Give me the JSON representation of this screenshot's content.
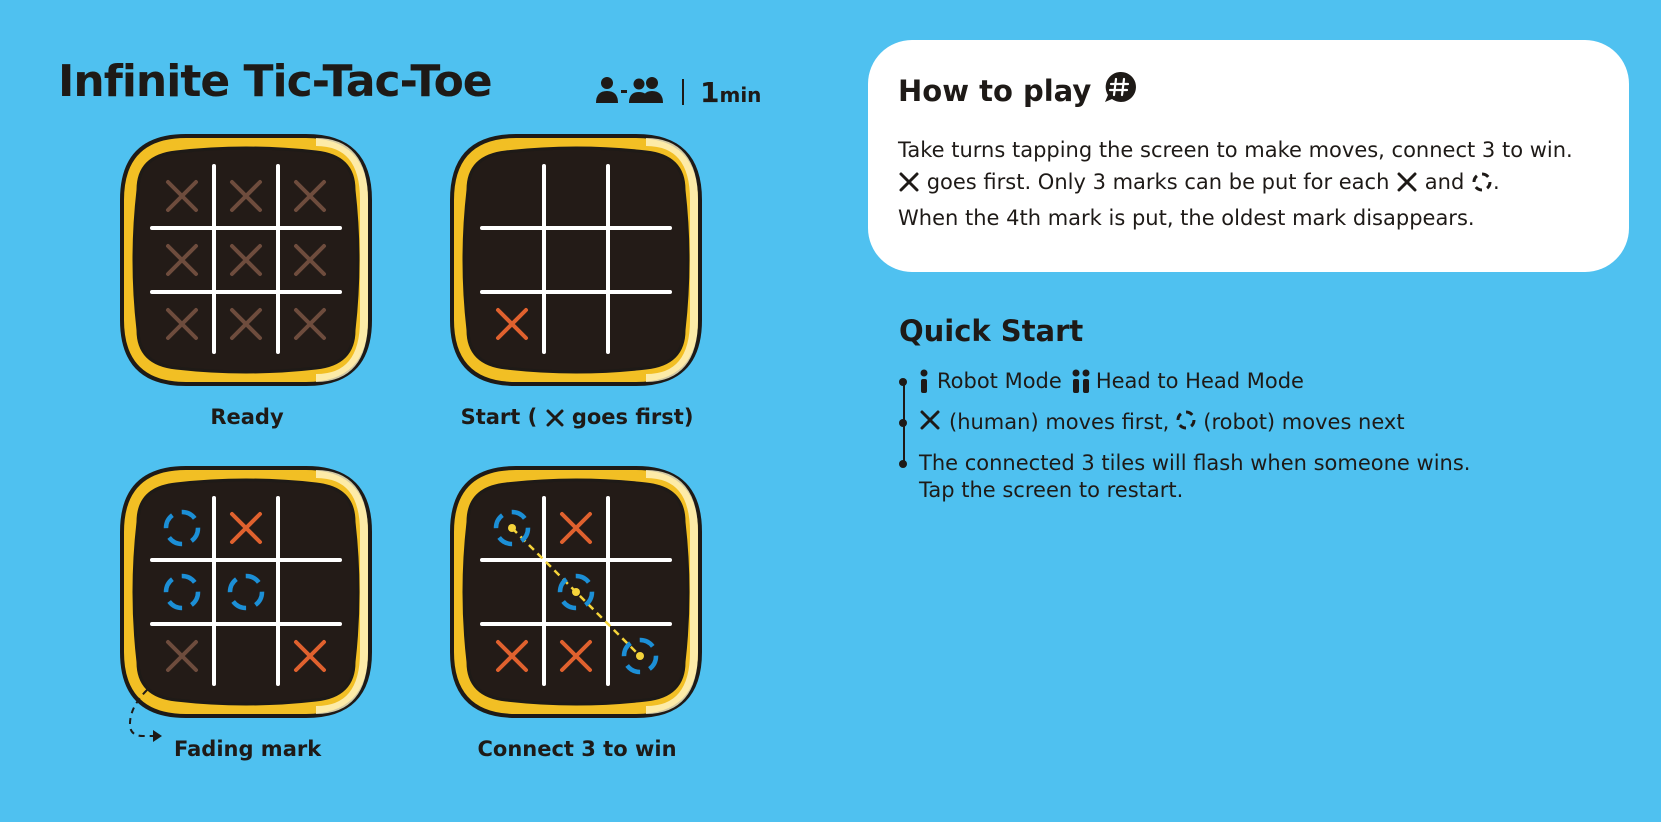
{
  "title": "Infinite Tic-Tac-Toe",
  "meta": {
    "players_icon": "one-to-two-players-icon",
    "duration_value": "1",
    "duration_unit": "min"
  },
  "colors": {
    "background": "#4fc1f0",
    "board_frame": "#f2bf24",
    "board_surface": "#231b17",
    "x_active": "#e0612e",
    "x_faded": "#6e4c3d",
    "o_mark": "#1c8fd6",
    "win_line": "#f5d33a"
  },
  "boards": [
    {
      "caption": "Ready",
      "cells": [
        "xf",
        "xf",
        "xf",
        "xf",
        "xf",
        "xf",
        "xf",
        "xf",
        "xf"
      ]
    },
    {
      "caption_prefix": "Start (",
      "caption_icon": "x-icon",
      "caption_suffix": "goes first)",
      "cells": [
        "",
        "",
        "",
        "",
        "",
        "",
        "x",
        "",
        ""
      ]
    },
    {
      "caption": "Fading mark",
      "cells": [
        "o",
        "x",
        "",
        "o",
        "o",
        "",
        "xf",
        "",
        "x"
      ]
    },
    {
      "caption": "Connect 3 to win",
      "cells": [
        "o",
        "x",
        "",
        "",
        "o",
        "",
        "x",
        "x",
        "o"
      ],
      "win_line": [
        0,
        4,
        8
      ]
    }
  ],
  "how_to_play": {
    "heading": "How to play",
    "icon": "hash-speech-bubble-icon",
    "text_1": "Take turns tapping the screen to make moves, connect 3 to win.",
    "text_2": "goes first. Only 3 marks can be put for each",
    "text_3": "and",
    "text_4": ".",
    "text_5": "When the 4th mark is put, the oldest mark disappears."
  },
  "quick_start": {
    "heading": "Quick Start",
    "robot_mode": "Robot Mode",
    "head_to_head_mode": "Head to Head Mode",
    "human_text": "(human) moves first,",
    "robot_text": "(robot) moves next",
    "connected_text": "The connected 3 tiles will flash when someone wins.\nTap the screen to restart."
  }
}
